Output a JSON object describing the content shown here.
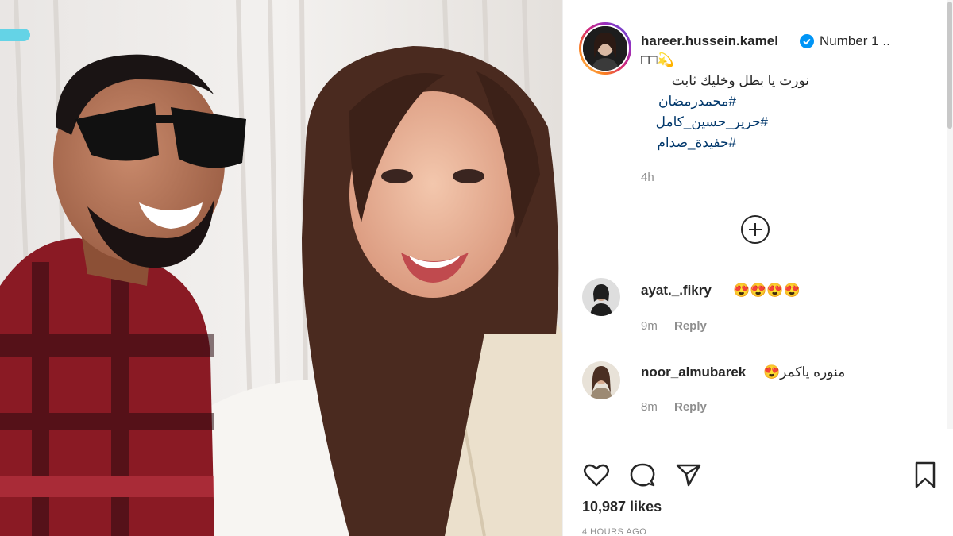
{
  "post": {
    "username": "hareer.hussein.kamel",
    "caption_first": "Number 1 ..",
    "caption_emoji": "□□💫",
    "caption_arabic": "نورت يا بطل وخليك ثابت",
    "hashtags": [
      "#محمدرمضان",
      "#حرير_حسين_كامل",
      "#حفيدة_صدام"
    ],
    "time": "4h"
  },
  "comments": [
    {
      "username": "ayat._.fikry",
      "text": "😍😍😍😍",
      "time": "9m",
      "reply_label": "Reply"
    },
    {
      "username": "noor_almubarek",
      "text": "منوره ياكمر😍",
      "time": "8m",
      "reply_label": "Reply"
    }
  ],
  "actions": {
    "icons": [
      "heart-icon",
      "comment-icon",
      "share-icon",
      "bookmark-icon"
    ]
  },
  "likes": "10,987 likes",
  "posted_ago": "4 HOURS AGO",
  "colors": {
    "accent": "#0095f6",
    "hashtag": "#00376b",
    "muted": "#8e8e8e"
  }
}
